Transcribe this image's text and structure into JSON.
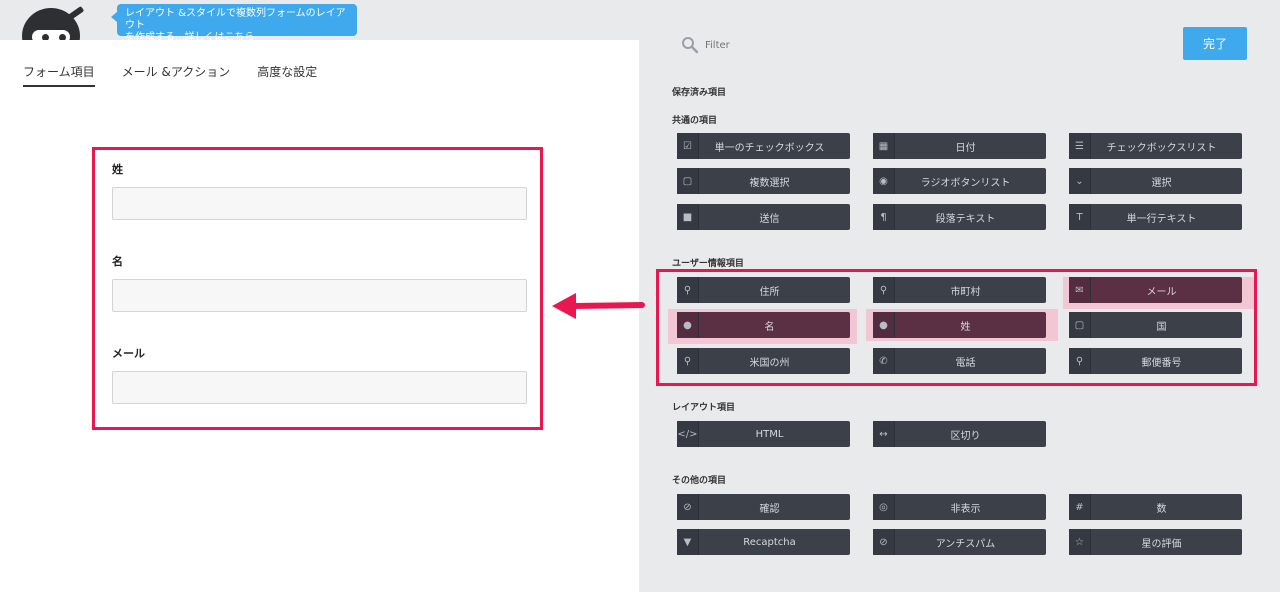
{
  "tooltip": {
    "line1": "レイアウト &スタイルで複数列フォームのレイアウト",
    "line2": "を作成する...詳しくはこちら"
  },
  "tabs": [
    "フォーム項目",
    "メール &アクション",
    "高度な設定"
  ],
  "form": {
    "fields": [
      "姓",
      "名",
      "メール"
    ]
  },
  "filter": {
    "placeholder": "Filter"
  },
  "done_label": "完了",
  "sections": {
    "saved": "保存済み項目",
    "common": "共通の項目",
    "user": "ユーザー情報項目",
    "layout": "レイアウト項目",
    "other": "その他の項目"
  },
  "common_items": [
    {
      "label": "単一のチェックボックス",
      "icon": "check-square-icon"
    },
    {
      "label": "日付",
      "icon": "calendar-icon"
    },
    {
      "label": "チェックボックスリスト",
      "icon": "list-icon"
    },
    {
      "label": "複数選択",
      "icon": "square-icon"
    },
    {
      "label": "ラジオボタンリスト",
      "icon": "radio-icon"
    },
    {
      "label": "選択",
      "icon": "chevron-down-icon"
    },
    {
      "label": "送信",
      "icon": "square-filled-icon"
    },
    {
      "label": "段落テキスト",
      "icon": "paragraph-icon"
    },
    {
      "label": "単一行テキスト",
      "icon": "text-icon"
    }
  ],
  "user_items": [
    {
      "label": "住所",
      "icon": "map-marker-icon"
    },
    {
      "label": "市町村",
      "icon": "map-marker-icon"
    },
    {
      "label": "メール",
      "icon": "envelope-icon"
    },
    {
      "label": "名",
      "icon": "user-icon"
    },
    {
      "label": "姓",
      "icon": "user-icon"
    },
    {
      "label": "国",
      "icon": "square-icon"
    },
    {
      "label": "米国の州",
      "icon": "map-marker-icon"
    },
    {
      "label": "電話",
      "icon": "phone-icon"
    },
    {
      "label": "郵便番号",
      "icon": "map-marker-icon"
    }
  ],
  "layout_items": [
    {
      "label": "HTML",
      "icon": "code-icon"
    },
    {
      "label": "区切り",
      "icon": "arrows-h-icon"
    }
  ],
  "other_items": [
    {
      "label": "確認",
      "icon": "check-circle-icon"
    },
    {
      "label": "非表示",
      "icon": "eye-slash-icon"
    },
    {
      "label": "数",
      "icon": "hash-icon"
    },
    {
      "label": "Recaptcha",
      "icon": "filter-icon"
    },
    {
      "label": "アンチスパム",
      "icon": "ban-icon"
    },
    {
      "label": "星の評価",
      "icon": "star-half-icon"
    }
  ],
  "colors": {
    "accent": "#3ea9ec",
    "highlight": "#e8174f",
    "button": "#3b4049",
    "selected_button": "#5b3044"
  }
}
